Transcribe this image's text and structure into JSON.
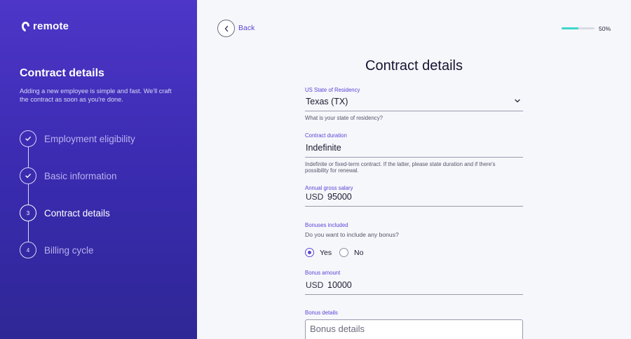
{
  "brand": {
    "name": "remote"
  },
  "sidebar": {
    "title": "Contract details",
    "description": "Adding a new employee is simple and fast. We'll craft the contract as soon as you're done.",
    "steps": [
      {
        "label": "Employment eligibility",
        "status": "done",
        "marker": ""
      },
      {
        "label": "Basic information",
        "status": "done",
        "marker": ""
      },
      {
        "label": "Contract details",
        "status": "current",
        "marker": "3"
      },
      {
        "label": "Billing cycle",
        "status": "upcoming",
        "marker": "4"
      }
    ]
  },
  "header": {
    "back_label": "Back",
    "progress_percent": 50,
    "progress_label": "50%"
  },
  "form": {
    "title": "Contract details",
    "state": {
      "label": "US State of Residency",
      "value": "Texas (TX)",
      "help": "What is your state of residency?"
    },
    "duration": {
      "label": "Contract duration",
      "value": "Indefinite",
      "help": "Indefinite or fixed-term contract. If the latter, please state duration and if there's possibility for renewal."
    },
    "salary": {
      "label": "Annual gross salary",
      "currency": "USD",
      "value": "95000"
    },
    "bonuses": {
      "label": "Bonuses included",
      "question": "Do you want to include any bonus?",
      "options": [
        "Yes",
        "No"
      ],
      "selected": "Yes"
    },
    "bonus_amount": {
      "label": "Bonus amount",
      "currency": "USD",
      "value": "10000"
    },
    "bonus_details": {
      "label": "Bonus details",
      "placeholder": "Bonus details"
    }
  },
  "colors": {
    "accent": "#5b45d6",
    "sidebar_top": "#4d36c8",
    "sidebar_bottom": "#2f2796",
    "progress": "#3ed6c9"
  }
}
